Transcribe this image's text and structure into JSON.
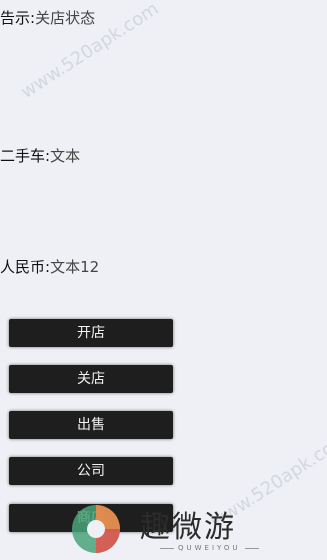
{
  "fields": {
    "notice": {
      "label": "告示:",
      "value": "关店状态"
    },
    "secondhand": {
      "label": "二手车:",
      "value": "文本"
    },
    "rmb": {
      "label": "人民币:",
      "value": "文本12"
    }
  },
  "buttons": {
    "open": "开店",
    "close": "关店",
    "sell": "出售",
    "company": "公司",
    "shop": "商店"
  },
  "watermark": "www.520apk.com",
  "brand": {
    "name": "趣微游",
    "sub": "QUWEIYOU",
    "colors": {
      "green": "#4aa37a",
      "orange": "#f08a4b",
      "red": "#e0584f"
    }
  }
}
